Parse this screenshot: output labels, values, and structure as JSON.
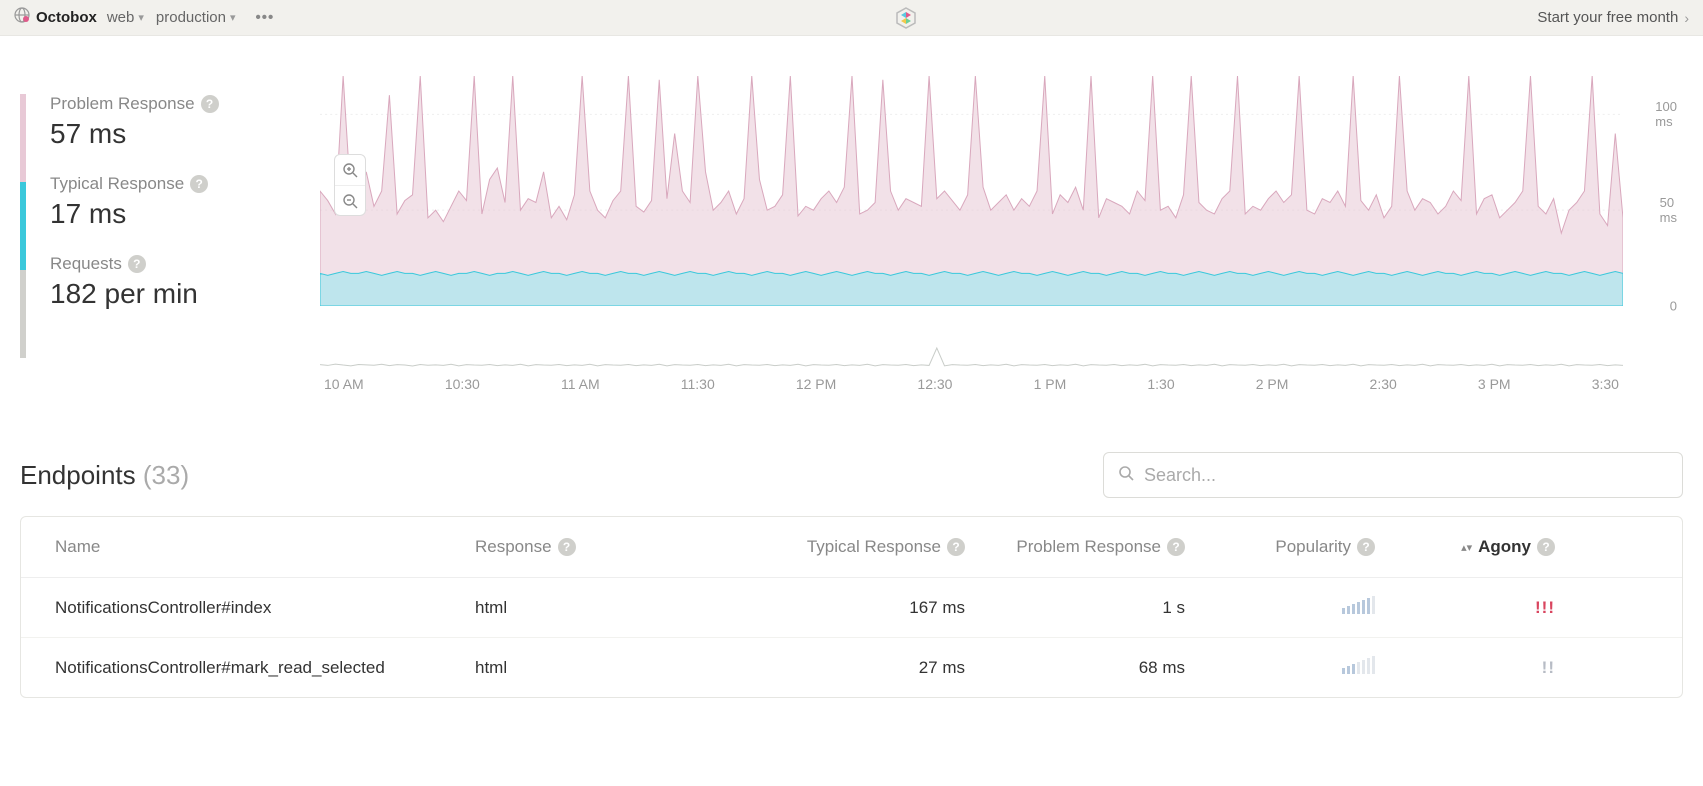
{
  "topbar": {
    "app_name": "Octobox",
    "crumb_service": "web",
    "crumb_env": "production",
    "cta": "Start your free month"
  },
  "metrics": {
    "problem": {
      "label": "Problem Response",
      "value": "57 ms"
    },
    "typical": {
      "label": "Typical Response",
      "value": "17 ms"
    },
    "requests": {
      "label": "Requests",
      "value": "182 per min"
    }
  },
  "chart_data": {
    "type": "area",
    "xlabel": "",
    "ylabel": "",
    "x_ticks": [
      "10 AM",
      "10:30",
      "11 AM",
      "11:30",
      "12 PM",
      "12:30",
      "1 PM",
      "1:30",
      "2 PM",
      "2:30",
      "3 PM",
      "3:30"
    ],
    "y_ticks": [
      "100 ms",
      "50 ms",
      "0"
    ],
    "ylim": [
      0,
      120
    ],
    "series": [
      {
        "name": "Problem Response",
        "color": "#e8c9d6",
        "values": [
          60,
          55,
          48,
          120,
          56,
          50,
          70,
          52,
          60,
          110,
          48,
          55,
          58,
          120,
          46,
          50,
          44,
          52,
          60,
          55,
          120,
          48,
          66,
          72,
          54,
          120,
          50,
          56,
          54,
          70,
          46,
          52,
          45,
          58,
          120,
          60,
          50,
          46,
          55,
          60,
          120,
          52,
          49,
          55,
          118,
          56,
          90,
          60,
          54,
          120,
          70,
          50,
          54,
          60,
          48,
          56,
          120,
          66,
          50,
          52,
          58,
          120,
          47,
          52,
          50,
          56,
          60,
          54,
          62,
          120,
          48,
          50,
          54,
          118,
          60,
          50,
          56,
          54,
          52,
          120,
          56,
          60,
          55,
          50,
          58,
          120,
          62,
          50,
          54,
          58,
          50,
          56,
          52,
          60,
          120,
          48,
          58,
          54,
          62,
          50,
          120,
          46,
          56,
          54,
          52,
          48,
          60,
          55,
          120,
          50,
          52,
          46,
          58,
          120,
          54,
          50,
          48,
          56,
          60,
          120,
          48,
          52,
          50,
          56,
          60,
          54,
          58,
          120,
          50,
          48,
          56,
          54,
          60,
          52,
          120,
          55,
          50,
          58,
          46,
          52,
          120,
          60,
          50,
          56,
          54,
          48,
          52,
          60,
          55,
          120,
          48,
          56,
          58,
          46,
          50,
          54,
          60,
          120,
          52,
          48,
          56,
          38,
          50,
          54,
          60,
          120,
          48,
          42,
          90,
          46
        ]
      },
      {
        "name": "Typical Response",
        "color": "#3bc8db",
        "values": [
          17,
          16,
          17,
          18,
          17,
          17,
          18,
          17,
          16,
          17,
          18,
          17,
          17,
          16,
          17,
          18,
          17,
          16,
          17,
          17,
          18,
          17,
          16,
          17,
          17,
          18,
          17,
          16,
          17,
          18,
          17,
          17,
          16,
          17,
          18,
          17,
          17,
          16,
          17,
          18,
          17,
          17,
          16,
          17,
          18,
          17,
          16,
          17,
          18,
          17,
          17,
          16,
          17,
          18,
          17,
          17,
          16,
          17,
          18,
          17,
          17,
          16,
          17,
          18,
          17,
          16,
          17,
          18,
          17,
          16,
          17,
          18,
          17,
          17,
          16,
          17,
          18,
          17,
          17,
          16,
          17,
          18,
          17,
          17,
          16,
          17,
          18,
          17,
          16,
          17,
          18,
          17,
          17,
          16,
          17,
          18,
          17,
          16,
          17,
          18,
          17,
          17,
          16,
          17,
          18,
          17,
          17,
          16,
          17,
          18,
          17,
          17,
          16,
          17,
          18,
          17,
          16,
          17,
          18,
          17,
          17,
          16,
          17,
          18,
          17,
          16,
          17,
          18,
          17,
          17,
          16,
          17,
          18,
          17,
          16,
          17,
          18,
          17,
          17,
          16,
          17,
          18,
          17,
          16,
          17,
          18,
          17,
          17,
          16,
          17,
          18,
          17,
          17,
          16,
          17,
          18,
          17,
          16,
          17,
          18,
          17,
          17,
          16,
          17,
          18,
          17,
          16,
          17,
          18,
          17
        ]
      }
    ],
    "requests_spark": [
      182,
      178,
      185,
      180,
      176,
      183,
      181,
      179,
      184,
      177,
      182,
      180,
      175,
      183,
      179,
      181,
      178,
      184,
      176,
      182,
      180,
      179,
      183,
      177,
      181,
      178,
      184,
      176,
      182,
      180,
      179,
      183,
      177,
      181,
      178,
      184,
      176,
      182,
      180,
      179,
      183,
      177,
      181,
      178,
      184,
      176,
      182,
      180,
      179,
      183,
      177,
      181,
      178,
      184,
      176,
      182,
      180,
      179,
      183,
      177,
      181,
      178,
      184,
      176,
      182,
      180,
      179,
      183,
      177,
      181,
      178,
      184,
      176,
      182,
      180,
      179,
      183,
      177,
      181,
      178,
      270,
      176,
      182,
      180,
      179,
      183,
      177,
      181,
      178,
      184,
      176,
      182,
      180,
      179,
      183,
      177,
      181,
      178,
      184,
      176,
      182,
      180,
      179,
      183,
      177,
      181,
      178,
      184,
      176,
      182,
      180,
      179,
      183,
      177,
      181,
      178,
      184,
      176,
      182,
      180,
      179,
      183,
      177,
      181,
      178,
      184,
      176,
      182,
      180,
      179,
      183,
      177,
      181,
      178,
      184,
      176,
      182,
      180,
      179,
      183,
      177,
      181,
      178,
      184,
      176,
      182,
      180,
      179,
      183,
      177,
      181,
      178,
      184,
      176,
      182,
      180,
      179,
      183,
      177,
      181,
      178,
      184,
      176,
      182,
      180,
      179,
      183,
      177,
      181,
      178
    ]
  },
  "endpoints": {
    "title": "Endpoints",
    "count": "(33)",
    "search_placeholder": "Search...",
    "columns": {
      "name": "Name",
      "response": "Response",
      "typical": "Typical Response",
      "problem": "Problem Response",
      "popularity": "Popularity",
      "agony": "Agony"
    },
    "rows": [
      {
        "name": "NotificationsController#index",
        "response": "html",
        "typical": "167 ms",
        "problem": "1 s",
        "popularity": 6,
        "agony": "!!!",
        "agony_style": "red"
      },
      {
        "name": "NotificationsController#mark_read_selected",
        "response": "html",
        "typical": "27 ms",
        "problem": "68 ms",
        "popularity": 3,
        "agony": "!!",
        "agony_style": "grey"
      }
    ]
  }
}
